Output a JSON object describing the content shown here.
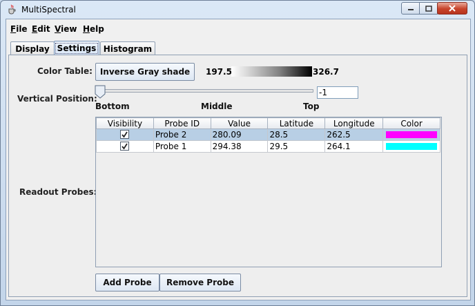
{
  "window": {
    "title": "MultiSpectral",
    "icons": {
      "app": "java-cup-icon",
      "minimize": "minimize-icon",
      "maximize": "maximize-icon",
      "close": "close-icon"
    }
  },
  "menubar": {
    "items": [
      {
        "label": "File",
        "mnemonic": "F",
        "rest": "ile"
      },
      {
        "label": "Edit",
        "mnemonic": "E",
        "rest": "dit"
      },
      {
        "label": "View",
        "mnemonic": "V",
        "rest": "iew"
      },
      {
        "label": "Help",
        "mnemonic": "H",
        "rest": "elp"
      }
    ]
  },
  "tabs": [
    {
      "label": "Display",
      "selected": false
    },
    {
      "label": "Settings",
      "selected": true
    },
    {
      "label": "Histogram",
      "selected": false
    }
  ],
  "settings": {
    "color_table": {
      "label": "Color Table:",
      "button": "Inverse Gray shade",
      "min": "197.5",
      "max": "326.7"
    },
    "vertical_position": {
      "label": "Vertical Position:",
      "value": "-1",
      "ticks": [
        "Bottom",
        "Middle",
        "Top"
      ]
    },
    "readout_probes": {
      "label": "Readout Probes:",
      "columns": [
        "Visibility",
        "Probe ID",
        "Value",
        "Latitude",
        "Longitude",
        "Color"
      ],
      "rows": [
        {
          "visible": true,
          "probe_id": "Probe 2",
          "value": "280.09",
          "latitude": "28.5",
          "longitude": "262.5",
          "color": "#ff00ff",
          "selected": true
        },
        {
          "visible": true,
          "probe_id": "Probe 1",
          "value": "294.38",
          "latitude": "29.5",
          "longitude": "264.1",
          "color": "#00ffff",
          "selected": false
        }
      ]
    },
    "buttons": {
      "add_probe": "Add Probe",
      "remove_probe": "Remove Probe"
    }
  }
}
